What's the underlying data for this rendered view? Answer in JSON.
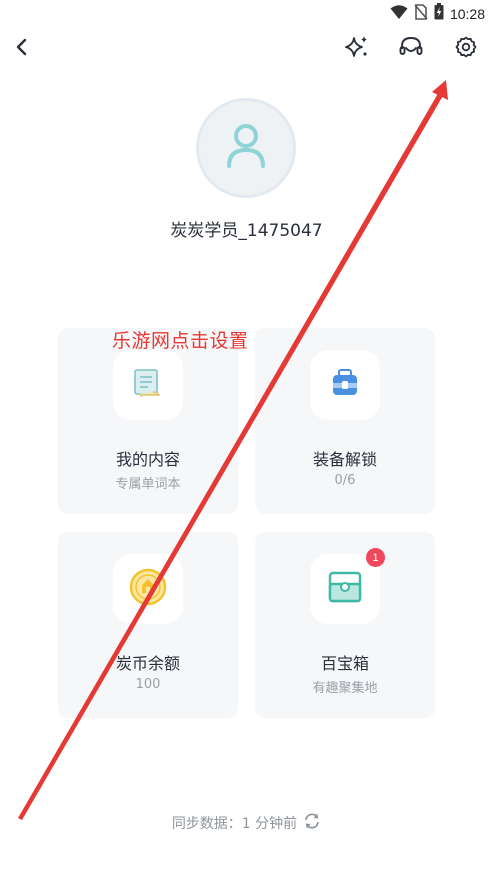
{
  "status_bar": {
    "time": "10:28",
    "icons": [
      "wifi-icon",
      "no-sim-icon",
      "battery-charging-icon"
    ]
  },
  "header": {
    "icons": [
      "back-arrow-icon",
      "sparkle-icon",
      "headset-icon",
      "gear-icon"
    ]
  },
  "profile": {
    "username": "炭炭学员_1475047"
  },
  "annotation": {
    "text": "乐游网点击设置",
    "color": "#e53935"
  },
  "cards": [
    {
      "title": "我的内容",
      "subtitle": "专属单词本",
      "icon": "document-scroll-icon"
    },
    {
      "title": "装备解锁",
      "subtitle": "0/6",
      "icon": "backpack-icon"
    },
    {
      "title": "炭币余额",
      "subtitle": "100",
      "icon": "coin-icon"
    },
    {
      "title": "百宝箱",
      "subtitle": "有趣聚集地",
      "icon": "treasure-box-icon",
      "badge": "1"
    }
  ],
  "sync": {
    "text": "同步数据：1 分钟前",
    "icon": "refresh-icon"
  },
  "colors": {
    "card_bg": "#f6f7f9",
    "accent_teal": "#3fb8a6",
    "accent_blue": "#4a8fe0",
    "coin_yellow": "#f2c230",
    "badge_red": "#f0475c"
  }
}
